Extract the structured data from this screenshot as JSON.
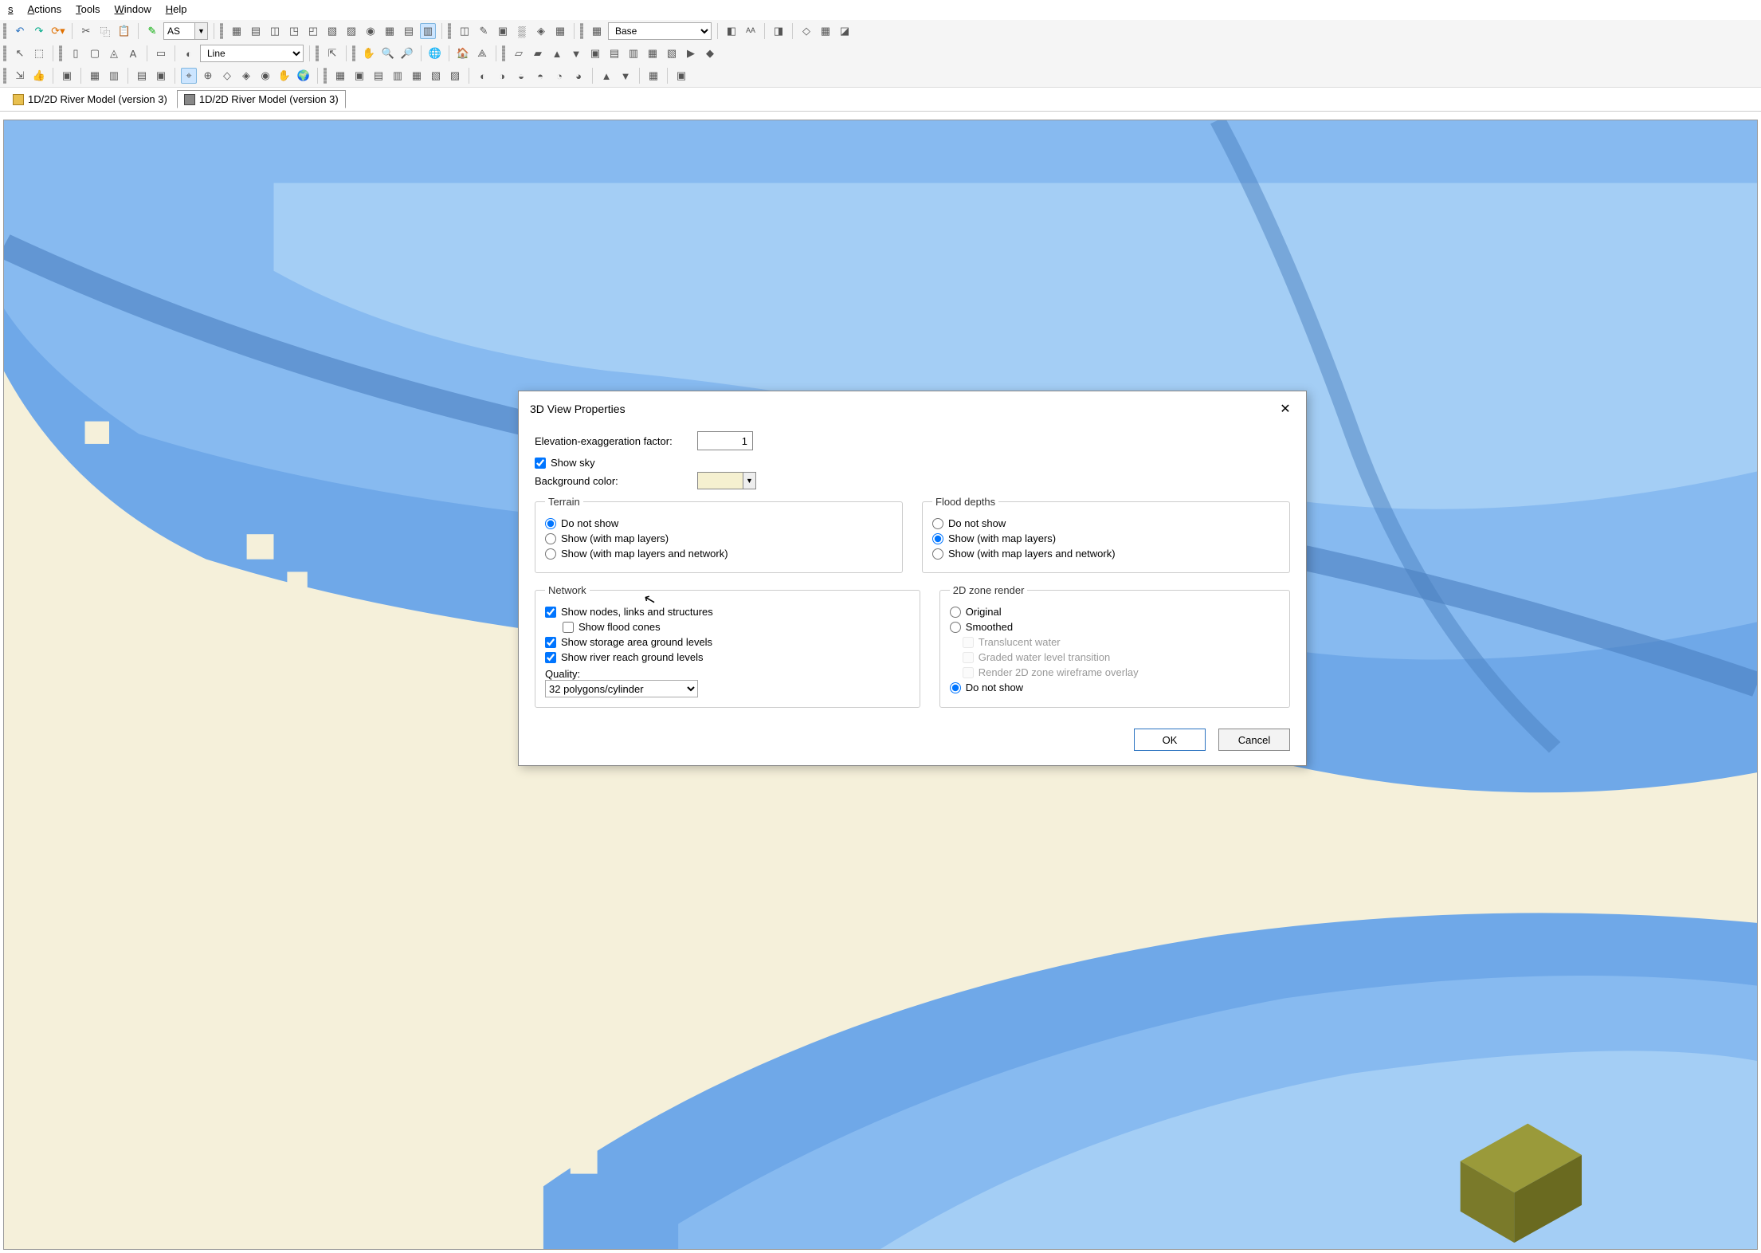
{
  "menu": {
    "items": [
      "s",
      "Actions",
      "Tools",
      "Window",
      "Help"
    ]
  },
  "toolbar_combos": {
    "as": "AS",
    "base": "Base",
    "line": "Line"
  },
  "tabs": [
    {
      "label": "1D/2D River Model (version 3)"
    },
    {
      "label": "1D/2D River Model (version 3)"
    }
  ],
  "dialog": {
    "title": "3D View Properties",
    "elevation_label": "Elevation-exaggeration factor:",
    "elevation_value": "1",
    "show_sky": "Show sky",
    "bg_label": "Background color:",
    "terrain": {
      "legend": "Terrain",
      "opt1": "Do not show",
      "opt2": "Show (with map layers)",
      "opt3": "Show (with map layers and network)"
    },
    "flood": {
      "legend": "Flood depths",
      "opt1": "Do not show",
      "opt2": "Show (with map layers)",
      "opt3": "Show (with map layers and network)"
    },
    "network": {
      "legend": "Network",
      "nodes": "Show nodes, links and structures",
      "cones": "Show flood cones",
      "storage": "Show storage area ground levels",
      "river": "Show river reach ground levels",
      "quality_label": "Quality:",
      "quality_value": "32 polygons/cylinder"
    },
    "zone": {
      "legend": "2D zone render",
      "original": "Original",
      "smoothed": "Smoothed",
      "translucent": "Translucent water",
      "graded": "Graded water level transition",
      "wireframe": "Render 2D zone wireframe overlay",
      "donot": "Do not show"
    },
    "ok": "OK",
    "cancel": "Cancel"
  }
}
